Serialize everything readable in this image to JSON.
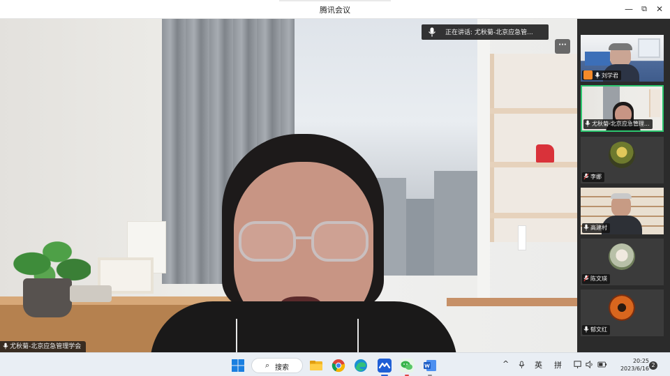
{
  "window": {
    "title": "腾讯会议",
    "minimize": "—",
    "maximize": "⧉",
    "close": "✕"
  },
  "meeting": {
    "speaking_text": "正在讲话:  尤秋菊-北京应急管...",
    "more_label": "···",
    "main_speaker_name": "尤秋菊-北京应急管理学会"
  },
  "participants": [
    {
      "name": "刘学君",
      "host": true,
      "active": false,
      "has_video": true
    },
    {
      "name": "尤秋菊-北京应急管理...",
      "host": false,
      "active": true,
      "has_video": true
    },
    {
      "name": "李娜",
      "host": false,
      "active": false,
      "has_video": false
    },
    {
      "name": "高建村",
      "host": false,
      "active": false,
      "has_video": true
    },
    {
      "name": "陈文瑛",
      "host": false,
      "active": false,
      "has_video": false
    },
    {
      "name": "郁文红",
      "host": false,
      "active": false,
      "has_video": false
    }
  ],
  "taskbar": {
    "search_label": "搜索",
    "search_icon": "search-icon",
    "tray": {
      "chevron": "^",
      "ime_lang": "英",
      "ime_mode": "拼"
    },
    "time": "20:25",
    "date": "2023/6/16",
    "notification_count": "2"
  },
  "colors": {
    "active_border": "#2cc66f",
    "host_badge": "#f58a2a",
    "taskbar_bg": "#e9eef4"
  }
}
